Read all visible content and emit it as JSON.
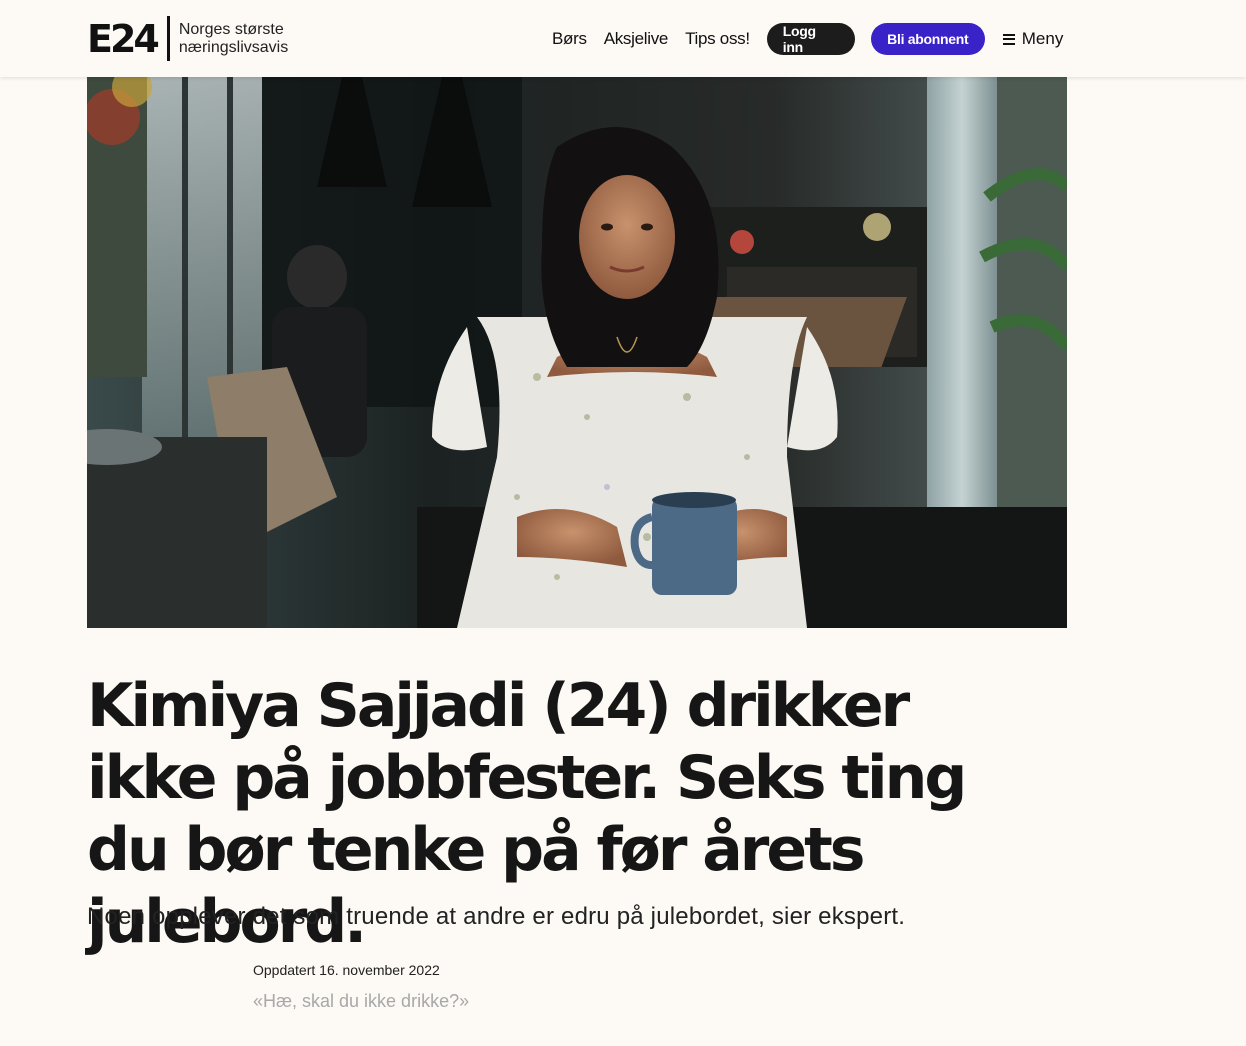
{
  "header": {
    "logo": "E24",
    "tagline_line1": "Norges største",
    "tagline_line2": "næringslivsavis",
    "nav": [
      "Børs",
      "Aksjelive",
      "Tips oss!"
    ],
    "login_label": "Logg inn",
    "subscribe_label": "Bli abonnent",
    "menu_label": "Meny"
  },
  "colors": {
    "background": "#fdf9f5",
    "login_button": "#1c1c1c",
    "subscribe_button": "#3a22c9",
    "text": "#161616"
  },
  "hero": {
    "icons": [
      "hero-photo-woman-with-coffee-mug"
    ]
  },
  "article": {
    "headline": "Kimiya Sajjadi (24) drikker ikke på jobbfester. Seks ting du bør tenke på før årets julebord.",
    "lede": "Noen opplever det som truende at andre er edru på julebordet, sier ekspert.",
    "updated": "Oppdatert 16. november 2022",
    "first_line": "«Hæ, skal du ikke drikke?»"
  }
}
